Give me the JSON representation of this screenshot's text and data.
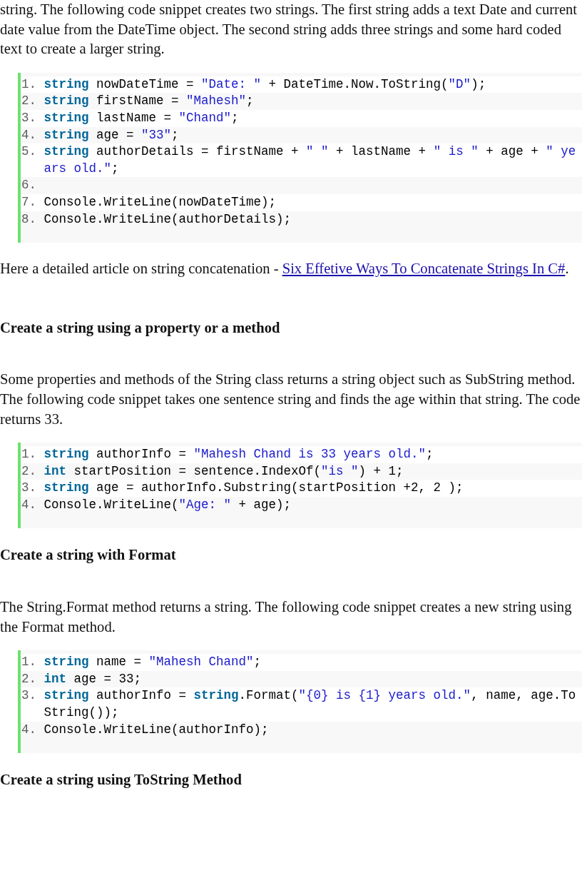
{
  "blocks": [
    {
      "kind": "paragraph",
      "text": "string. The following code snippet creates two strings. The first string adds a text Date and current date value from the DateTime object. The second string adds three strings and some hard coded text to create a larger string."
    },
    {
      "kind": "code",
      "lines": [
        {
          "number": "1.",
          "tokens": [
            {
              "kind": "keyword",
              "text": "string"
            },
            {
              "kind": "plain",
              "text": " nowDateTime = "
            },
            {
              "kind": "string",
              "text": "\"Date: \""
            },
            {
              "kind": "plain",
              "text": " + DateTime.Now.ToString("
            },
            {
              "kind": "string",
              "text": "\"D\""
            },
            {
              "kind": "plain",
              "text": ");"
            }
          ]
        },
        {
          "number": "2.",
          "tokens": [
            {
              "kind": "keyword",
              "text": "string"
            },
            {
              "kind": "plain",
              "text": " firstName = "
            },
            {
              "kind": "string",
              "text": "\"Mahesh\""
            },
            {
              "kind": "plain",
              "text": ";"
            }
          ]
        },
        {
          "number": "3.",
          "tokens": [
            {
              "kind": "keyword",
              "text": "string"
            },
            {
              "kind": "plain",
              "text": " lastName = "
            },
            {
              "kind": "string",
              "text": "\"Chand\""
            },
            {
              "kind": "plain",
              "text": ";"
            }
          ]
        },
        {
          "number": "4.",
          "tokens": [
            {
              "kind": "keyword",
              "text": "string"
            },
            {
              "kind": "plain",
              "text": " age = "
            },
            {
              "kind": "string",
              "text": "\"33\""
            },
            {
              "kind": "plain",
              "text": ";"
            }
          ]
        },
        {
          "number": "5.",
          "tokens": [
            {
              "kind": "keyword",
              "text": "string"
            },
            {
              "kind": "plain",
              "text": " authorDetails = firstName + "
            },
            {
              "kind": "string",
              "text": "\" \""
            },
            {
              "kind": "plain",
              "text": " + lastName + "
            },
            {
              "kind": "string",
              "text": "\" is \""
            },
            {
              "kind": "plain",
              "text": " + age + "
            },
            {
              "kind": "string",
              "text": "\" years old.\""
            },
            {
              "kind": "plain",
              "text": ";"
            }
          ]
        },
        {
          "number": "6."
        },
        {
          "number": "7.",
          "tokens": [
            {
              "kind": "plain",
              "text": "Console.WriteLine(nowDateTime);"
            }
          ]
        },
        {
          "number": "8.",
          "tokens": [
            {
              "kind": "plain",
              "text": "Console.WriteLine(authorDetails);"
            }
          ]
        }
      ]
    },
    {
      "kind": "paragraph",
      "text": "Here a detailed article on string concatenation - ",
      "link": "Six Effetive Ways To Concatenate Strings In C#",
      "after": "."
    },
    {
      "kind": "heading",
      "text": "Create a string using a property or a method"
    },
    {
      "kind": "paragraph",
      "text": "Some properties and methods of the String class returns a string object such as SubString method. The following code snippet takes one sentence string and finds the age within that string. The code returns 33."
    },
    {
      "kind": "code",
      "lines": [
        {
          "number": "1.",
          "tokens": [
            {
              "kind": "keyword",
              "text": "string"
            },
            {
              "kind": "plain",
              "text": " authorInfo = "
            },
            {
              "kind": "string",
              "text": "\"Mahesh Chand is 33 years old.\""
            },
            {
              "kind": "plain",
              "text": ";"
            }
          ]
        },
        {
          "number": "2.",
          "tokens": [
            {
              "kind": "keyword",
              "text": "int"
            },
            {
              "kind": "plain",
              "text": " startPosition = sentence.IndexOf("
            },
            {
              "kind": "string",
              "text": "\"is \""
            },
            {
              "kind": "plain",
              "text": ") + 1;"
            }
          ]
        },
        {
          "number": "3.",
          "tokens": [
            {
              "kind": "keyword",
              "text": "string"
            },
            {
              "kind": "plain",
              "text": " age = authorInfo.Substring(startPosition +2, 2 );"
            }
          ]
        },
        {
          "number": "4.",
          "tokens": [
            {
              "kind": "plain",
              "text": "Console.WriteLine("
            },
            {
              "kind": "string",
              "text": "\"Age: \""
            },
            {
              "kind": "plain",
              "text": " + age);"
            }
          ]
        }
      ]
    },
    {
      "kind": "heading",
      "text": "Create a string with Format"
    },
    {
      "kind": "paragraph",
      "text": "The String.Format method returns a string. The following code snippet creates a new string using the Format method."
    },
    {
      "kind": "code",
      "lines": [
        {
          "number": "1.",
          "tokens": [
            {
              "kind": "keyword",
              "text": "string"
            },
            {
              "kind": "plain",
              "text": " name = "
            },
            {
              "kind": "string",
              "text": "\"Mahesh Chand\""
            },
            {
              "kind": "plain",
              "text": ";"
            }
          ]
        },
        {
          "number": "2.",
          "tokens": [
            {
              "kind": "keyword",
              "text": "int"
            },
            {
              "kind": "plain",
              "text": " age = 33;"
            }
          ]
        },
        {
          "number": "3.",
          "tokens": [
            {
              "kind": "keyword",
              "text": "string"
            },
            {
              "kind": "plain",
              "text": " authorInfo = "
            },
            {
              "kind": "keyword",
              "text": "string"
            },
            {
              "kind": "plain",
              "text": ".Format("
            },
            {
              "kind": "string",
              "text": "\"{0} is {1} years old.\""
            },
            {
              "kind": "plain",
              "text": ", name, age.ToString());"
            }
          ]
        },
        {
          "number": "4.",
          "tokens": [
            {
              "kind": "plain",
              "text": "Console.WriteLine(authorInfo);"
            }
          ]
        }
      ]
    },
    {
      "kind": "heading",
      "text": "Create a string using ToString Method"
    }
  ]
}
